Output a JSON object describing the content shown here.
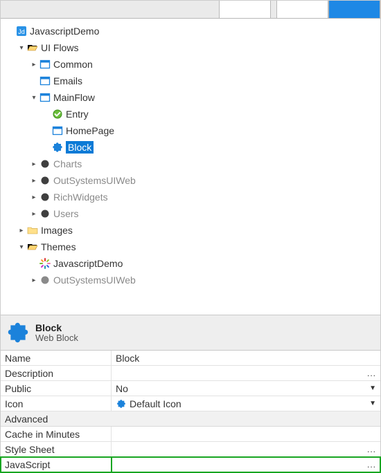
{
  "tree": {
    "root": "JavascriptDemo",
    "uiflows": "UI Flows",
    "common": "Common",
    "emails": "Emails",
    "mainflow": "MainFlow",
    "entry": "Entry",
    "homepage": "HomePage",
    "block": "Block",
    "charts": "Charts",
    "outsystemsuiweb": "OutSystemsUIWeb",
    "richwidgets": "RichWidgets",
    "users": "Users",
    "images": "Images",
    "themes": "Themes",
    "theme_js": "JavascriptDemo",
    "theme_os": "OutSystemsUIWeb"
  },
  "header": {
    "title": "Block",
    "subtitle": "Web Block"
  },
  "props": {
    "name_k": "Name",
    "name_v": "Block",
    "desc_k": "Description",
    "desc_v": "",
    "public_k": "Public",
    "public_v": "No",
    "icon_k": "Icon",
    "icon_v": "Default Icon",
    "section_adv": "Advanced",
    "cache_k": "Cache in Minutes",
    "cache_v": "",
    "ss_k": "Style Sheet",
    "ss_v": "",
    "js_k": "JavaScript",
    "js_v": ""
  }
}
